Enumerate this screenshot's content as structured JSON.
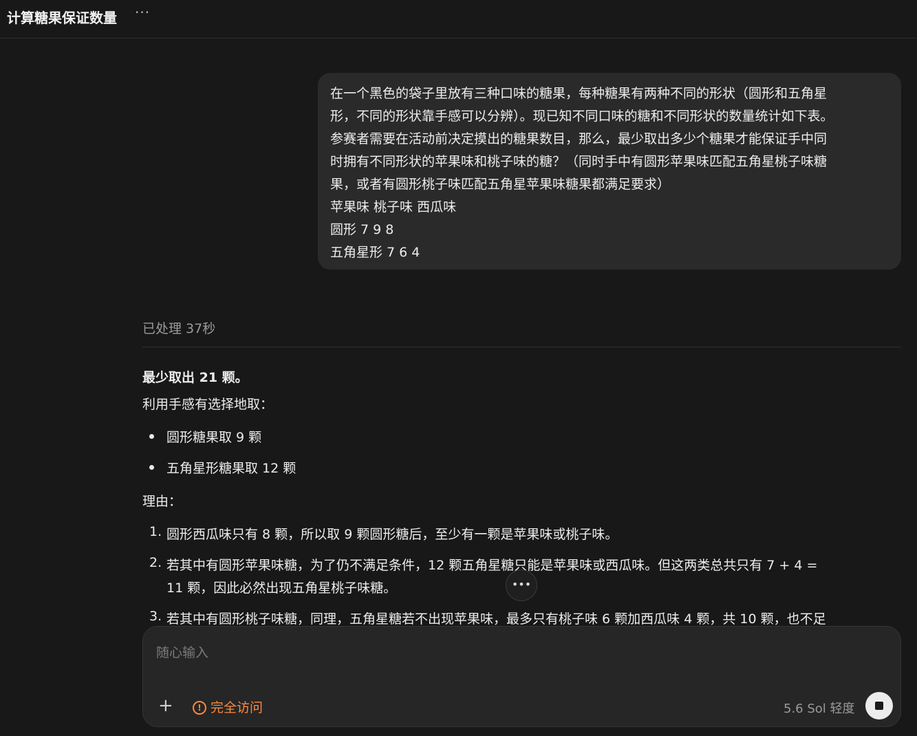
{
  "header": {
    "title": "计算糖果保证数量",
    "more_label": "···"
  },
  "user_message": {
    "lines": [
      "在一个黑色的袋子里放有三种口味的糖果，每种糖果有两种不同的形状（圆形和五角星",
      "形，不同的形状靠手感可以分辨）。现已知不同口味的糖和不同形状的数量统计如下表。",
      "参赛者需要在活动前决定摸出的糖果数目，那么，最少取出多少个糖果才能保证手中同",
      "时拥有不同形状的苹果味和桃子味的糖？（同时手中有圆形苹果味匹配五角星桃子味糖",
      "果，或者有圆形桃子味匹配五角星苹果味糖果都满足要求）",
      "苹果味 桃子味 西瓜味",
      "圆形 7 9 8",
      "五角星形 7 6 4"
    ]
  },
  "processed": "已处理 37秒",
  "answer": {
    "lead": "最少取出 21 颗。",
    "intro": "利用手感有选择地取：",
    "bullets": [
      "圆形糖果取 9 颗",
      "五角星形糖果取 12 颗"
    ],
    "reason_label": "理由：",
    "reasons": [
      {
        "num": "1.",
        "lines": [
          "圆形西瓜味只有 8 颗，所以取 9 颗圆形糖后，至少有一颗是苹果味或桃子味。"
        ]
      },
      {
        "num": "2.",
        "lines": [
          "若其中有圆形苹果味糖，为了仍不满足条件，12 颗五角星糖只能是苹果味或西瓜味。但这两类总共只有 7 + 4 =",
          "11 颗，因此必然出现五角星桃子味糖。"
        ]
      },
      {
        "num": "3.",
        "lines": [
          "若其中有圆形桃子味糖，同理，五角星糖若不出现苹果味，最多只有桃子味 6 颗加西瓜味 4 颗，共 10 颗，也不足"
        ]
      }
    ]
  },
  "scroll_button": "•••",
  "composer": {
    "placeholder": "随心输入",
    "plus_label": "+",
    "access_icon": "!",
    "access_label": "完全访问",
    "model_label": "5.6 Sol  轻度"
  },
  "colors": {
    "background": "#181818",
    "bubble": "#2a2a2a",
    "accent": "#ff8a3d"
  }
}
